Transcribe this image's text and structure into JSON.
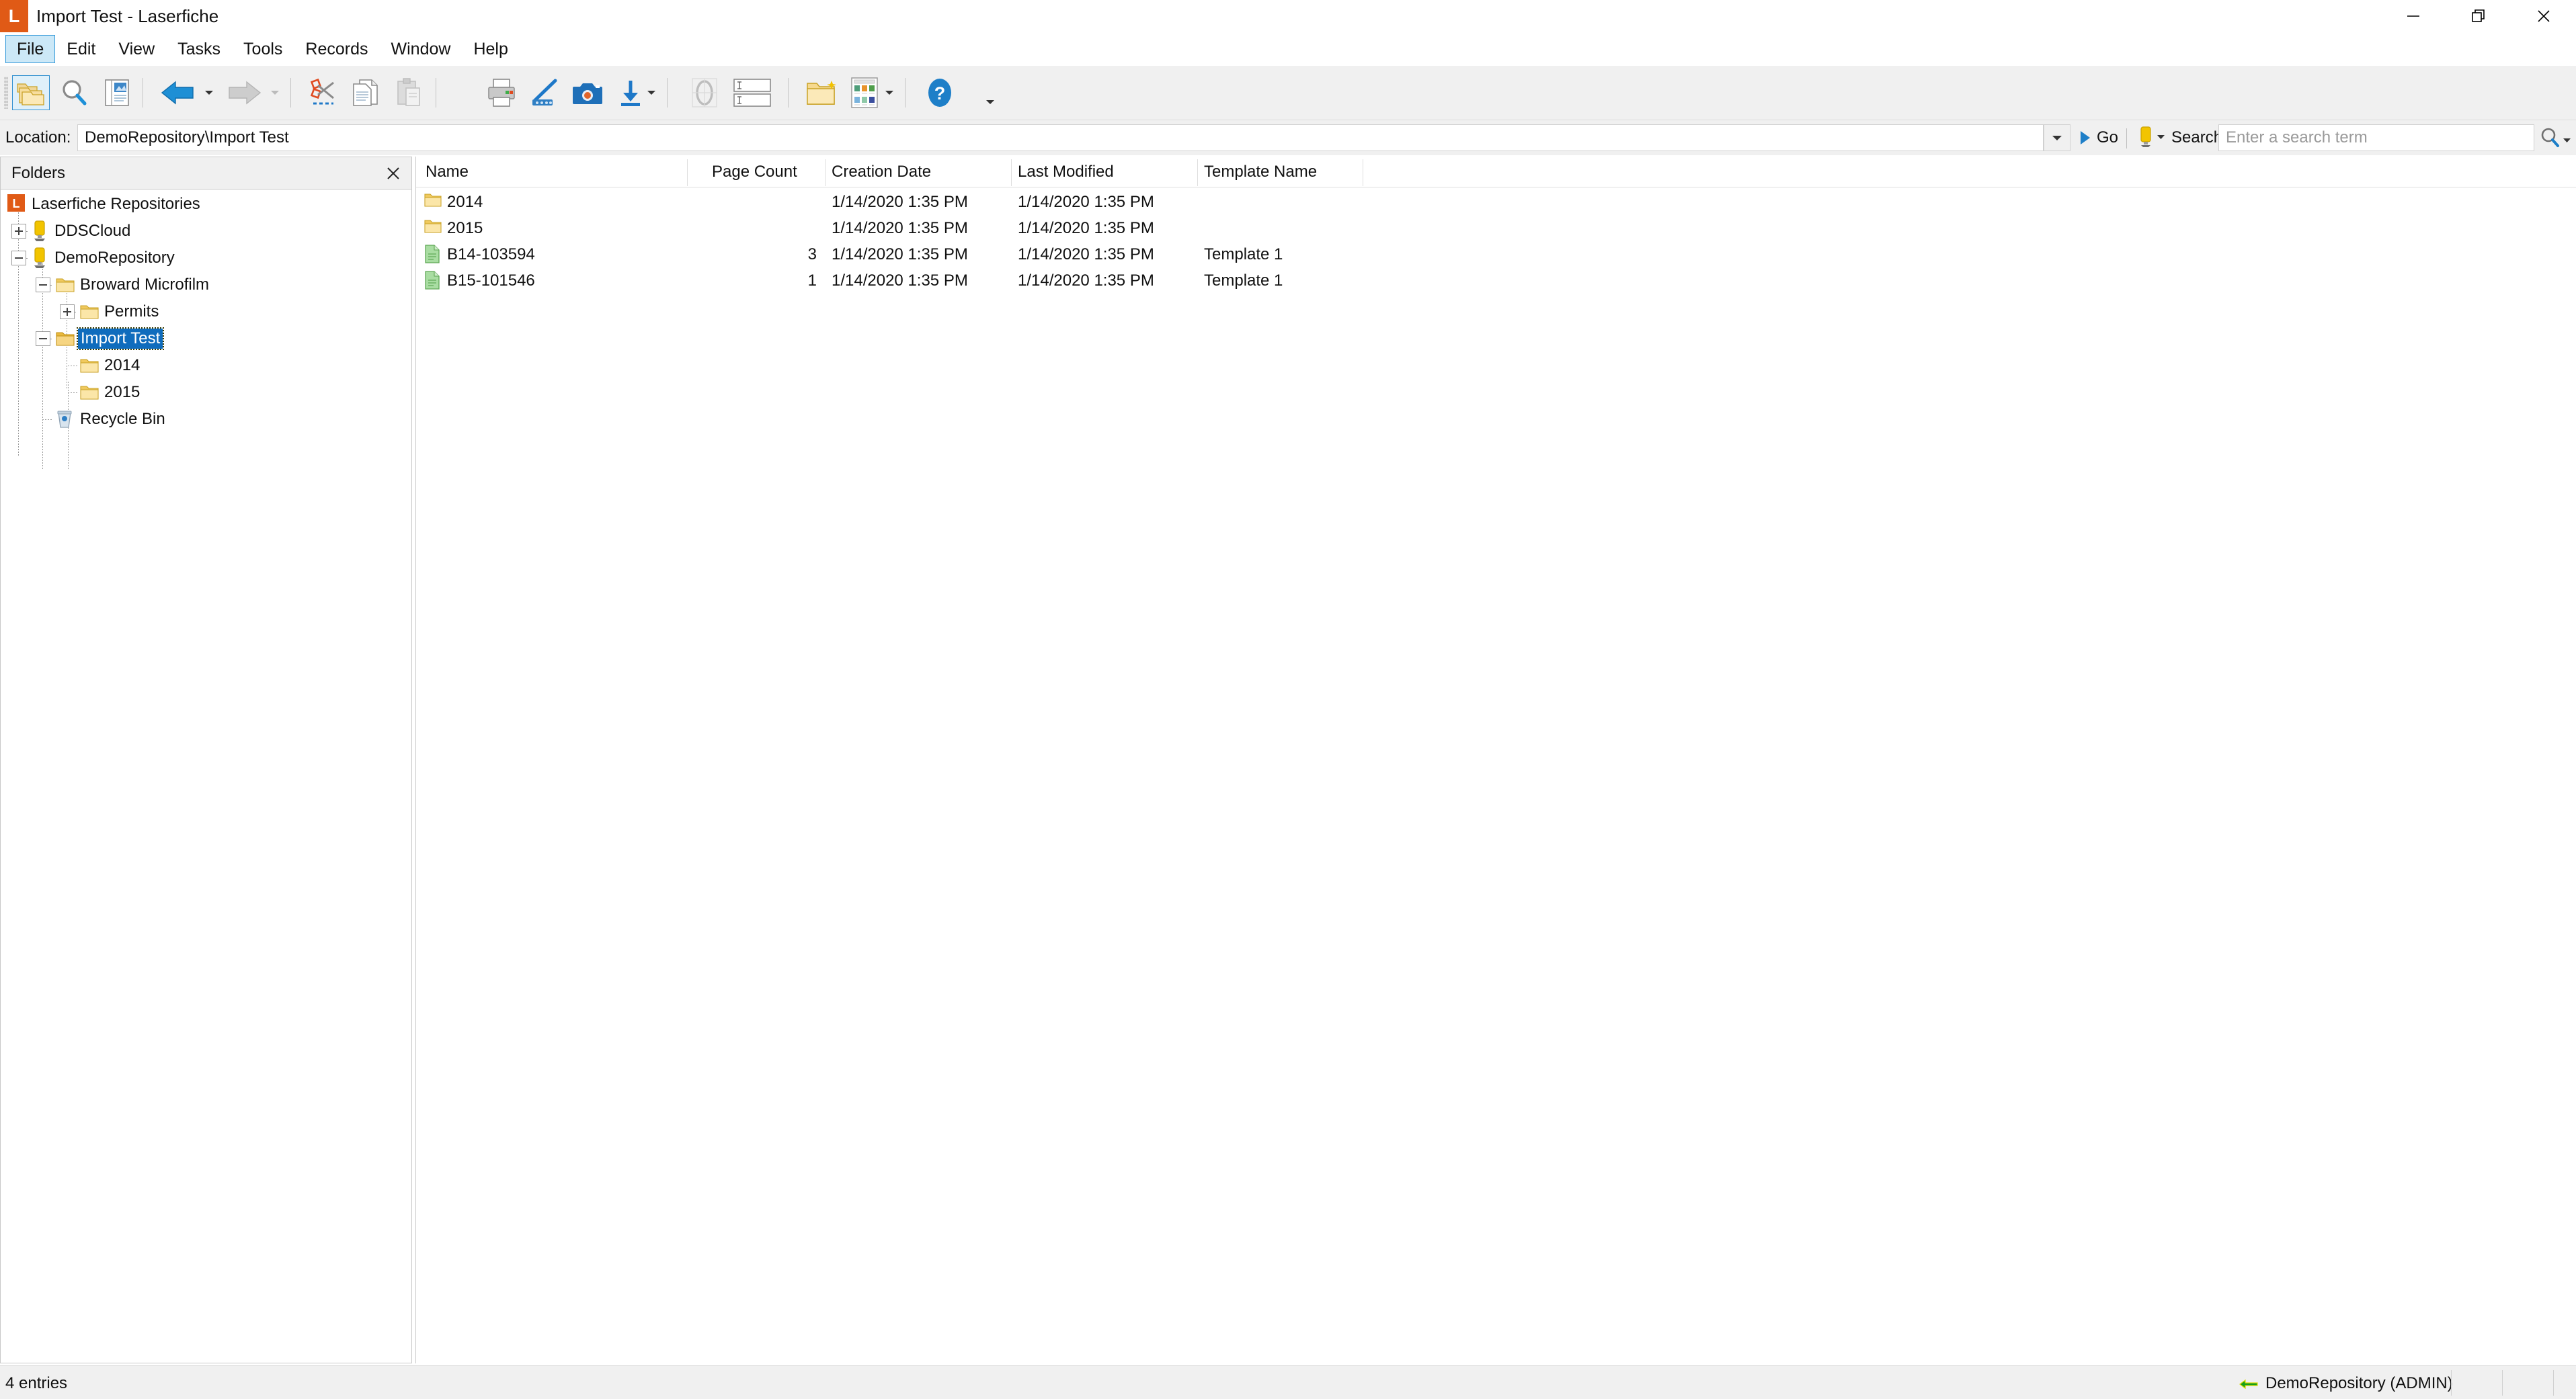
{
  "window": {
    "title": "Import Test - Laserfiche",
    "logo_letter": "L",
    "logo_color": "#e05a16",
    "controls": [
      {
        "name": "minimize",
        "glyph": "minimize-icon"
      },
      {
        "name": "restore",
        "glyph": "restore-icon"
      },
      {
        "name": "close",
        "glyph": "close-icon"
      }
    ]
  },
  "menubar": {
    "items": [
      {
        "label": "File",
        "active": true
      },
      {
        "label": "Edit",
        "active": false
      },
      {
        "label": "View",
        "active": false
      },
      {
        "label": "Tasks",
        "active": false
      },
      {
        "label": "Tools",
        "active": false
      },
      {
        "label": "Records",
        "active": false
      },
      {
        "label": "Window",
        "active": false
      },
      {
        "label": "Help",
        "active": false
      }
    ]
  },
  "toolbar": {
    "buttons": [
      {
        "name": "browse-folders-icon",
        "selected": true
      },
      {
        "name": "search-icon",
        "selected": false
      },
      {
        "name": "document-viewer-icon",
        "selected": false
      },
      {
        "name": "back-icon",
        "selected": false,
        "enabled": true
      },
      {
        "name": "forward-icon",
        "selected": false,
        "enabled": false
      },
      {
        "name": "cut-icon",
        "selected": false
      },
      {
        "name": "copy-icon",
        "selected": false
      },
      {
        "name": "paste-icon",
        "selected": false,
        "enabled": false
      },
      {
        "name": "print-icon",
        "selected": false
      },
      {
        "name": "scan-icon",
        "selected": false
      },
      {
        "name": "snapshot-icon",
        "selected": false
      },
      {
        "name": "import-icon",
        "selected": false
      },
      {
        "name": "annotations-icon",
        "selected": false,
        "enabled": false
      },
      {
        "name": "fields-icon",
        "selected": false
      },
      {
        "name": "new-folder-icon",
        "selected": false
      },
      {
        "name": "thumbnails-icon",
        "selected": false
      },
      {
        "name": "help-icon",
        "selected": false
      }
    ]
  },
  "location": {
    "label": "Location:",
    "value": "DemoRepository\\Import Test",
    "go_label": "Go",
    "dropdown": "chevron-down-icon"
  },
  "search": {
    "label": "Search:",
    "placeholder": "Enter a search term",
    "value": "",
    "icon": "search-icon"
  },
  "folders_panel": {
    "title": "Folders",
    "close_icon": "close-icon",
    "tree": [
      {
        "label": "Laserfiche Repositories",
        "depth": 0,
        "icon": "laserfiche-logo-icon",
        "expander": "none",
        "selected": false
      },
      {
        "label": "DDSCloud",
        "depth": 1,
        "icon": "repository-icon",
        "expander": "plus",
        "selected": false
      },
      {
        "label": "DemoRepository",
        "depth": 1,
        "icon": "repository-icon",
        "expander": "minus",
        "selected": false
      },
      {
        "label": "Broward Microfilm",
        "depth": 2,
        "icon": "folder-icon",
        "expander": "minus",
        "selected": false
      },
      {
        "label": "Permits",
        "depth": 3,
        "icon": "folder-icon",
        "expander": "plus",
        "selected": false
      },
      {
        "label": "Import Test",
        "depth": 2,
        "icon": "folder-icon",
        "expander": "minus",
        "selected": true
      },
      {
        "label": "2014",
        "depth": 3,
        "icon": "folder-icon",
        "expander": "none",
        "selected": false
      },
      {
        "label": "2015",
        "depth": 3,
        "icon": "folder-icon",
        "expander": "none",
        "selected": false
      },
      {
        "label": "Recycle Bin",
        "depth": 2,
        "icon": "recycle-bin-icon",
        "expander": "none",
        "selected": false
      }
    ]
  },
  "listview": {
    "columns": [
      {
        "label": "Name",
        "key": "name",
        "align": "left"
      },
      {
        "label": "Page Count",
        "key": "page_count",
        "align": "right"
      },
      {
        "label": "Creation Date",
        "key": "creation_date",
        "align": "left"
      },
      {
        "label": "Last Modified",
        "key": "last_modified",
        "align": "left"
      },
      {
        "label": "Template Name",
        "key": "template_name",
        "align": "left"
      }
    ],
    "rows": [
      {
        "name": "2014",
        "icon": "folder-icon",
        "page_count": "",
        "creation_date": "1/14/2020 1:35 PM",
        "last_modified": "1/14/2020 1:35 PM",
        "template_name": ""
      },
      {
        "name": "2015",
        "icon": "folder-icon",
        "page_count": "",
        "creation_date": "1/14/2020 1:35 PM",
        "last_modified": "1/14/2020 1:35 PM",
        "template_name": ""
      },
      {
        "name": "B14-103594",
        "icon": "document-icon",
        "page_count": "3",
        "creation_date": "1/14/2020 1:35 PM",
        "last_modified": "1/14/2020 1:35 PM",
        "template_name": "Template 1"
      },
      {
        "name": "B15-101546",
        "icon": "document-icon",
        "page_count": "1",
        "creation_date": "1/14/2020 1:35 PM",
        "last_modified": "1/14/2020 1:35 PM",
        "template_name": "Template 1"
      }
    ]
  },
  "statusbar": {
    "entries_text": "4 entries",
    "repository": "DemoRepository (ADMIN)",
    "connection_icon": "connected-icon"
  },
  "colors": {
    "selection_blue": "#0f6cbd",
    "menu_highlight": "#cce8f7",
    "toolbar_bg": "#f0f0f0",
    "accent_orange": "#e05a16",
    "folder_yellow": "#f5c54a",
    "document_green": "#a8dba0"
  }
}
